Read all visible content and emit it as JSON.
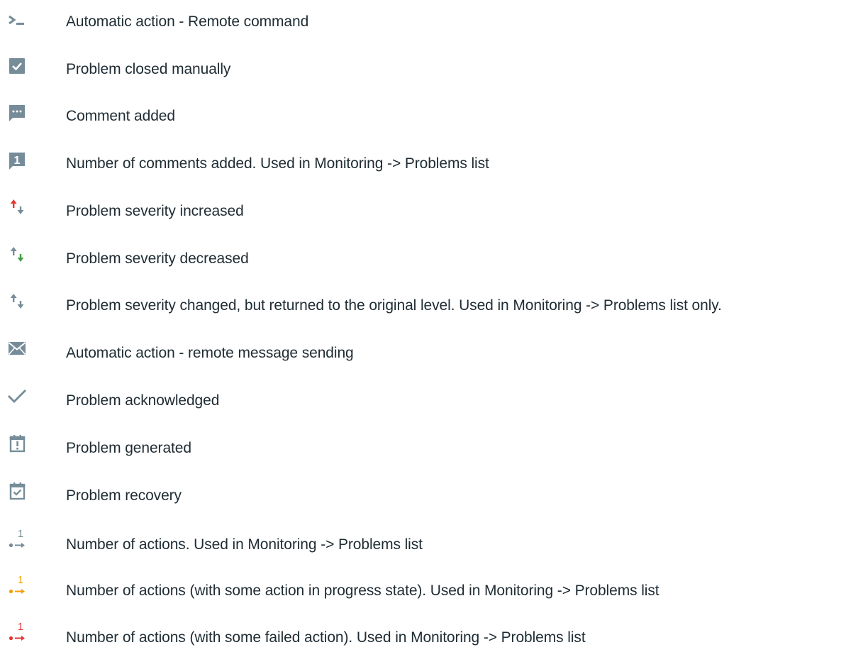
{
  "legend": {
    "items": [
      {
        "icon": "remote-command-icon",
        "label": "Automatic action - Remote command"
      },
      {
        "icon": "checkbox-checked-icon",
        "label": "Problem closed manually"
      },
      {
        "icon": "comment-icon",
        "label": "Comment added"
      },
      {
        "icon": "comment-count-icon",
        "label": "Number of comments added. Used in Monitoring -> Problems list",
        "count": "1"
      },
      {
        "icon": "severity-increased-icon",
        "label": "Problem severity increased"
      },
      {
        "icon": "severity-decreased-icon",
        "label": "Problem severity decreased"
      },
      {
        "icon": "severity-changed-icon",
        "label": "Problem severity changed, but returned to the original level. Used in Monitoring -> Problems list only."
      },
      {
        "icon": "envelope-icon",
        "label": "Automatic action - remote message sending"
      },
      {
        "icon": "checkmark-icon",
        "label": "Problem acknowledged"
      },
      {
        "icon": "calendar-exclamation-icon",
        "label": "Problem generated"
      },
      {
        "icon": "calendar-check-icon",
        "label": "Problem recovery"
      },
      {
        "icon": "actions-count-icon",
        "label": "Number of actions. Used in Monitoring -> Problems list",
        "count": "1"
      },
      {
        "icon": "actions-in-progress-icon",
        "label": "Number of actions (with some action in progress state). Used in Monitoring -> Problems list",
        "count": "1"
      },
      {
        "icon": "actions-failed-icon",
        "label": "Number of actions (with some failed action). Used in Monitoring -> Problems list",
        "count": "1"
      }
    ]
  },
  "colors": {
    "icon_gray": "#768d99",
    "text": "#1f2c33",
    "red": "#e33734",
    "green": "#429e47",
    "orange": "#f4a000"
  }
}
